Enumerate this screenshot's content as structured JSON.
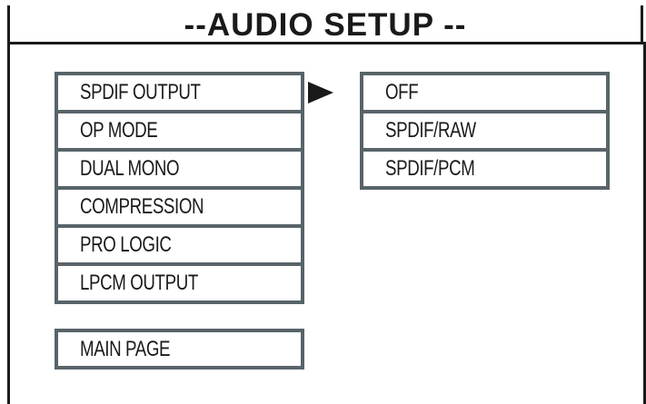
{
  "title": "--AUDIO SETUP --",
  "left_menu": {
    "items": [
      {
        "label": "SPDIF OUTPUT"
      },
      {
        "label": "OP MODE"
      },
      {
        "label": "DUAL MONO"
      },
      {
        "label": "COMPRESSION"
      },
      {
        "label": "PRO  LOGIC"
      },
      {
        "label": "LPCM OUTPUT"
      }
    ],
    "main_page_label": "MAIN PAGE"
  },
  "submenu": {
    "options": [
      {
        "label": "OFF"
      },
      {
        "label": "SPDIF/RAW"
      },
      {
        "label": "SPDIF/PCM"
      }
    ]
  },
  "icons": {
    "selection_arrow": "play-arrow-icon"
  },
  "colors": {
    "box_border": "#586469",
    "text": "#1a1a1a",
    "background": "#ffffff"
  }
}
